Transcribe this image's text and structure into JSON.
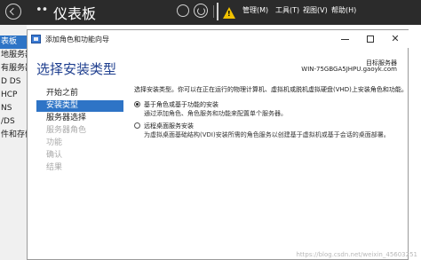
{
  "server_manager": {
    "title": "仪表板",
    "title_arrows": "••",
    "menu": [
      "管理(M)",
      "工具(T)",
      "视图(V)",
      "帮助(H)"
    ],
    "sidebar": [
      {
        "label": "表板",
        "active": true
      },
      {
        "label": "地服务器",
        "active": false
      },
      {
        "label": "有服务器",
        "active": false
      },
      {
        "label": "D DS",
        "active": false
      },
      {
        "label": "HCP",
        "active": false
      },
      {
        "label": "NS",
        "active": false
      },
      {
        "label": "/DS",
        "active": false
      },
      {
        "label": "件和存储",
        "active": false
      }
    ],
    "warning_mark": "!"
  },
  "wizard": {
    "title": "添加角色和功能向导",
    "heading": "选择安装类型",
    "target_label": "目标服务器",
    "target_value": "WIN-75GBGA5JHPU.gaoyk.com",
    "nav": [
      {
        "label": "开始之前",
        "state": "normal"
      },
      {
        "label": "安装类型",
        "state": "active"
      },
      {
        "label": "服务器选择",
        "state": "normal"
      },
      {
        "label": "服务器角色",
        "state": "disabled"
      },
      {
        "label": "功能",
        "state": "disabled"
      },
      {
        "label": "确认",
        "state": "disabled"
      },
      {
        "label": "结果",
        "state": "disabled"
      }
    ],
    "description": "选择安装类型。你可以在正在运行的物理计算机、虚拟机或脱机虚拟硬盘(VHD)上安装角色和功能。",
    "options": [
      {
        "title": "基于角色或基于功能的安装",
        "desc": "通过添加角色、角色服务和功能来配置单个服务器。",
        "checked": true
      },
      {
        "title": "远程桌面服务安装",
        "desc": "为虚拟桌面基础结构(VDI)安装所需的角色服务以创建基于虚拟机或基于会话的桌面部署。",
        "checked": false
      }
    ]
  },
  "watermark": "https://blog.csdn.net/weixin_45603251"
}
